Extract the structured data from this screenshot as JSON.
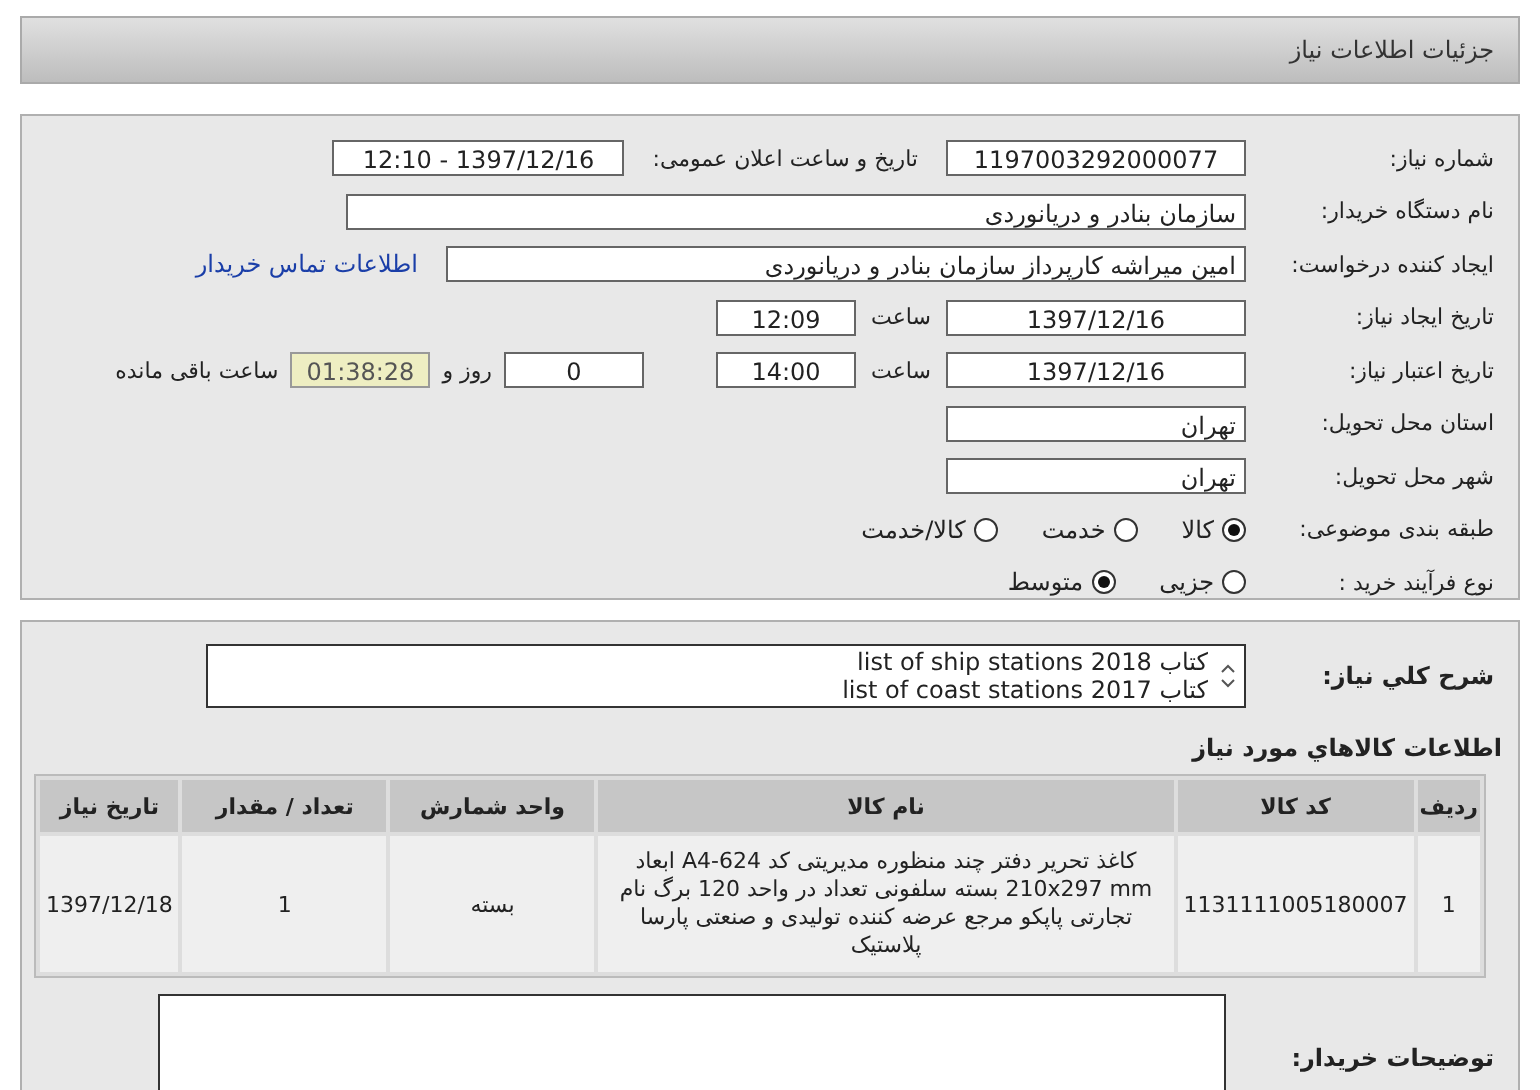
{
  "header": {
    "title": "جزئیات اطلاعات نیاز"
  },
  "form": {
    "need_number": {
      "label": "شماره نیاز:",
      "value": "1197003292000077"
    },
    "announce": {
      "label": "تاریخ و ساعت اعلان عمومی:",
      "value": "1397/12/16 - 12:10"
    },
    "buyer": {
      "label": "نام دستگاه خریدار:",
      "value": "سازمان بنادر و دریانوردی"
    },
    "requester": {
      "label": "ایجاد کننده درخواست:",
      "value": "امین میراشه کارپرداز سازمان بنادر و دریانوردی",
      "link": "اطلاعات تماس خریدار"
    },
    "created": {
      "label": "تاریخ ایجاد نیاز:",
      "date": "1397/12/16",
      "time_label": "ساعت",
      "time": "12:09"
    },
    "deadline": {
      "label": "تاریخ اعتبار نیاز:",
      "date": "1397/12/16",
      "time_label": "ساعت",
      "time": "14:00",
      "days": "0",
      "days_label": "روز و",
      "remaining": "01:38:28",
      "remaining_label": "ساعت باقی مانده"
    },
    "province": {
      "label": "استان محل تحویل:",
      "value": "تهران"
    },
    "city": {
      "label": "شهر محل تحویل:",
      "value": "تهران"
    },
    "category": {
      "label": "طبقه بندی موضوعی:",
      "options": [
        {
          "label": "کالا",
          "selected": true
        },
        {
          "label": "خدمت",
          "selected": false
        },
        {
          "label": "کالا/خدمت",
          "selected": false
        }
      ]
    },
    "process": {
      "label": "نوع فرآیند خرید :",
      "options": [
        {
          "label": "جزیی",
          "selected": false
        },
        {
          "label": "متوسط",
          "selected": true
        }
      ]
    }
  },
  "description": {
    "label": "شرح کلي نياز:",
    "lines": [
      "کتاب list of ship stations 2018",
      "کتاب list of coast stations 2017"
    ]
  },
  "goods": {
    "title": "اطلاعات کالاهاي مورد نياز",
    "columns": [
      "ردیف",
      "کد کالا",
      "نام کالا",
      "واحد شمارش",
      "تعداد / مقدار",
      "تاریخ نیاز"
    ],
    "rows": [
      [
        "1",
        "1131111005180007",
        "کاغذ تحریر دفتر چند منظوره مدیریتی کد A4-624 ابعاد 210x297 mm بسته سلفونی تعداد در واحد 120 برگ نام تجارتی پاپکو مرجع عرضه کننده تولیدی و صنعتی پارسا پلاستیک",
        "بسته",
        "1",
        "1397/12/18"
      ]
    ]
  },
  "buyer_notes": {
    "label": "توضیحات خریدار:"
  }
}
